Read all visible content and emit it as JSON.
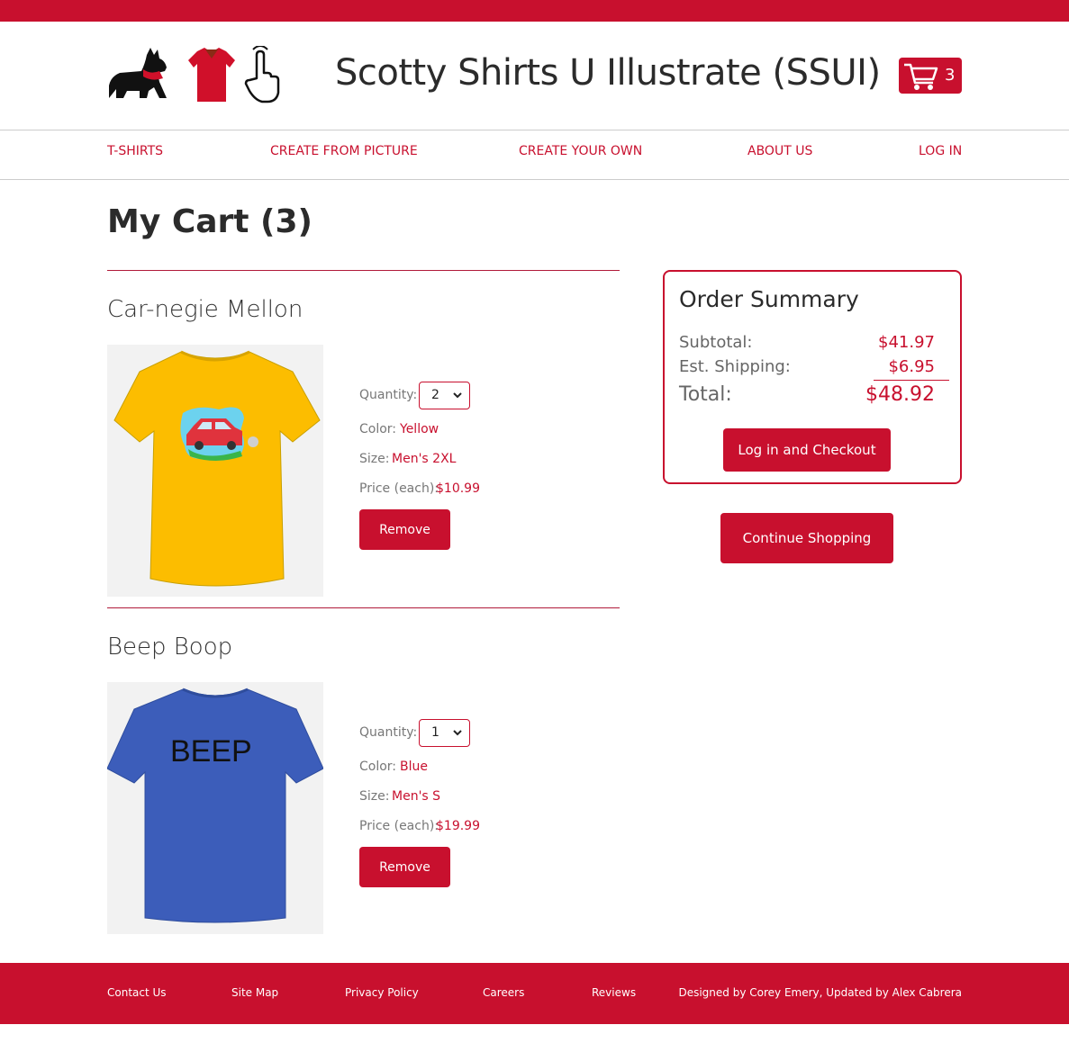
{
  "header": {
    "title": "Scotty Shirts U Illustrate (SSUI)",
    "cart_count": "3",
    "logo_icons": [
      "scottie-dog-icon",
      "red-shirt-icon",
      "pointer-hand-icon"
    ],
    "cart_icon": "shopping-cart-icon"
  },
  "nav": {
    "items": [
      {
        "label": "T-SHIRTS"
      },
      {
        "label": "CREATE FROM PICTURE"
      },
      {
        "label": "CREATE YOUR OWN"
      },
      {
        "label": "ABOUT US"
      },
      {
        "label": "LOG IN"
      }
    ]
  },
  "page": {
    "heading": "My Cart (3)"
  },
  "cart": {
    "labels": {
      "quantity": "Quantity:",
      "color": "Color:",
      "size": "Size:",
      "price": "Price (each):",
      "remove": "Remove"
    },
    "items": [
      {
        "name": "Car-negie Mellon",
        "quantity": "2",
        "color": "Yellow",
        "size": "Men's 2XL",
        "price": "$10.99",
        "shirt_color": "#fcbd00",
        "design": "car-icon"
      },
      {
        "name": "Beep Boop",
        "quantity": "1",
        "color": "Blue",
        "size": "Men's S",
        "price": "$19.99",
        "shirt_color": "#3c5dba",
        "design_text": "BEEP"
      }
    ]
  },
  "summary": {
    "title": "Order Summary",
    "subtotal_label": "Subtotal:",
    "subtotal": "$41.97",
    "shipping_label": "Est. Shipping:",
    "shipping": "$6.95",
    "total_label": "Total:",
    "total": "$48.92",
    "checkout_label": "Log in and Checkout"
  },
  "continue_label": "Continue Shopping",
  "footer": {
    "links": [
      {
        "label": "Contact Us"
      },
      {
        "label": "Site Map"
      },
      {
        "label": "Privacy Policy"
      },
      {
        "label": "Careers"
      },
      {
        "label": "Reviews"
      }
    ],
    "credit": "Designed by Corey Emery, Updated by Alex Cabrera"
  },
  "colors": {
    "brand": "#c8102e",
    "text": "#2b2b2b",
    "muted": "#777777"
  }
}
